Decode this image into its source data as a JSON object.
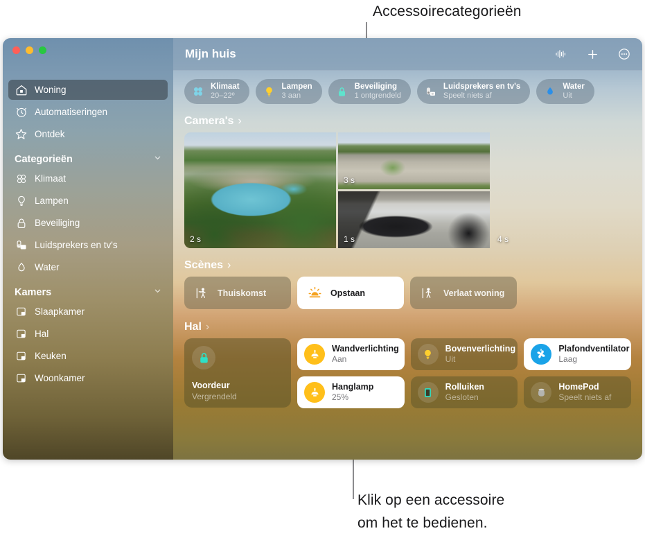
{
  "annotations": {
    "top": "Accessoirecategorieën",
    "bottom_line1": "Klik op een accessoire",
    "bottom_line2": "om het te bedienen."
  },
  "window": {
    "traffic_lights": [
      "close-button",
      "minimize-button",
      "zoom-button"
    ]
  },
  "titlebar": {
    "title": "Mijn huis",
    "actions": [
      {
        "name": "siri-waveform-icon",
        "label": ""
      },
      {
        "name": "add-icon",
        "label": ""
      },
      {
        "name": "more-options-icon",
        "label": ""
      }
    ]
  },
  "sidebar": {
    "top_items": [
      {
        "label": "Woning",
        "icon": "house-icon",
        "selected": true
      },
      {
        "label": "Automatiseringen",
        "icon": "automation-clock-icon",
        "selected": false
      },
      {
        "label": "Ontdek",
        "icon": "star-icon",
        "selected": false
      }
    ],
    "categories_header": "Categorieën",
    "categories": [
      {
        "label": "Klimaat",
        "icon": "fan-icon"
      },
      {
        "label": "Lampen",
        "icon": "lightbulb-icon"
      },
      {
        "label": "Beveiliging",
        "icon": "lock-icon"
      },
      {
        "label": "Luidsprekers en tv's",
        "icon": "speaker-tv-icon"
      },
      {
        "label": "Water",
        "icon": "water-drop-icon"
      }
    ],
    "rooms_header": "Kamers",
    "rooms": [
      {
        "label": "Slaapkamer",
        "icon": "room-icon"
      },
      {
        "label": "Hal",
        "icon": "room-icon"
      },
      {
        "label": "Keuken",
        "icon": "room-icon"
      },
      {
        "label": "Woonkamer",
        "icon": "room-icon"
      }
    ]
  },
  "category_pills": [
    {
      "name": "Klimaat",
      "state": "20–22º",
      "icon": "fan-icon",
      "color": "#7fd4e8"
    },
    {
      "name": "Lampen",
      "state": "3 aan",
      "icon": "lightbulb-icon",
      "color": "#ffcf2e"
    },
    {
      "name": "Beveiliging",
      "state": "1 ontgrendeld",
      "icon": "lock-icon",
      "color": "#5fe3cd"
    },
    {
      "name": "Luidsprekers en tv's",
      "state": "Speelt niets af",
      "icon": "speaker-tv-icon",
      "color": "#e8e8e8"
    },
    {
      "name": "Water",
      "state": "Uit",
      "icon": "water-drop-icon",
      "color": "#2b8fe8"
    }
  ],
  "cameras_section": {
    "header": "Camera's",
    "arrow": "›",
    "cameras": [
      {
        "name": "pool-camera",
        "timestamp": "2 s",
        "scene": "pool"
      },
      {
        "name": "driveway-camera",
        "timestamp": "3 s",
        "scene": "driveway"
      },
      {
        "name": "garage-camera",
        "timestamp": "1 s",
        "scene": "garage"
      },
      {
        "name": "living-room-camera",
        "timestamp": "4 s",
        "scene": "living"
      }
    ]
  },
  "scenes_section": {
    "header": "Scènes",
    "arrow": "›",
    "scenes": [
      {
        "label": "Thuiskomst",
        "icon": "walk-in-icon",
        "active": false
      },
      {
        "label": "Opstaan",
        "icon": "sunrise-icon",
        "active": true
      },
      {
        "label": "Verlaat woning",
        "icon": "walk-out-icon",
        "active": false
      }
    ]
  },
  "hal_section": {
    "header": "Hal",
    "arrow": "›",
    "door": {
      "name": "Voordeur",
      "state": "Vergrendeld",
      "icon": "lock-icon",
      "color": "#2ee0c6"
    },
    "accessories": [
      {
        "name": "Wandverlichting",
        "state": "Aan",
        "icon": "wall-light-icon",
        "on": true,
        "color": "#ffbf1a"
      },
      {
        "name": "Bovenverlichting",
        "state": "Uit",
        "icon": "lightbulb-icon",
        "on": false,
        "color": "#ffcf2e"
      },
      {
        "name": "Plafondventilator",
        "state": "Laag",
        "icon": "ceiling-fan-icon",
        "on": true,
        "color": "#1aa3e8"
      },
      {
        "name": "Hanglamp",
        "state": "25%",
        "icon": "wall-light-icon",
        "on": true,
        "color": "#ffbf1a"
      },
      {
        "name": "Rolluiken",
        "state": "Gesloten",
        "icon": "blinds-icon",
        "on": false,
        "color": "#2ee0c6"
      },
      {
        "name": "HomePod",
        "state": "Speelt niets af",
        "icon": "homepod-icon",
        "on": false,
        "color": "#b4b4b0"
      }
    ]
  }
}
